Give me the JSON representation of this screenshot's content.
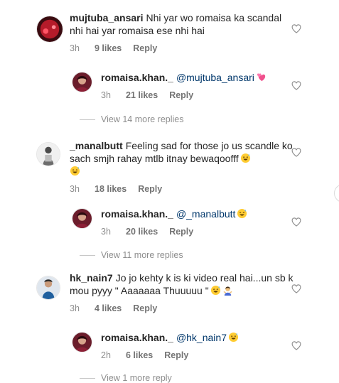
{
  "comments": [
    {
      "username": "mujtuba_ansari",
      "text": "Nhi yar wo romaisa ka scandal nhi hai yar romaisa ese nhi hai",
      "time": "3h",
      "likes": "9 likes",
      "reply_label": "Reply"
    },
    {
      "username": "romaisa.khan._",
      "mention": "@mujtuba_ansari",
      "emoji": "two-hearts",
      "time": "3h",
      "likes": "21 likes",
      "reply_label": "Reply"
    },
    {
      "username": "_manalbutt",
      "text": "Feeling sad for those jo us scandle ko sach smjh rahay mtlb itnay bewaqoofff",
      "emoji": "smiling-sweat",
      "time": "3h",
      "likes": "18 likes",
      "reply_label": "Reply"
    },
    {
      "username": "romaisa.khan._",
      "mention": "@_manalbutt",
      "emoji": "smiling-sweat",
      "time": "3h",
      "likes": "20 likes",
      "reply_label": "Reply"
    },
    {
      "username": "hk_nain7",
      "text": "Jo jo kehty k is ki video real hai...un sb k mou pyyy \" Aaaaaaa Thuuuuu \"",
      "emoji": "smiling-sweat, person-gesturing",
      "time": "3h",
      "likes": "4 likes",
      "reply_label": "Reply"
    },
    {
      "username": "romaisa.khan._",
      "mention": "@hk_nain7",
      "emoji": "smiling-sweat",
      "time": "2h",
      "likes": "6 likes",
      "reply_label": "Reply"
    }
  ],
  "view_more": [
    "View 14 more replies",
    "View 11 more replies",
    "View 1 more reply"
  ],
  "colors": {
    "text": "#262626",
    "meta": "#8e8e8e",
    "mention": "#00376b",
    "heart_outline": "#8e8e8e"
  }
}
